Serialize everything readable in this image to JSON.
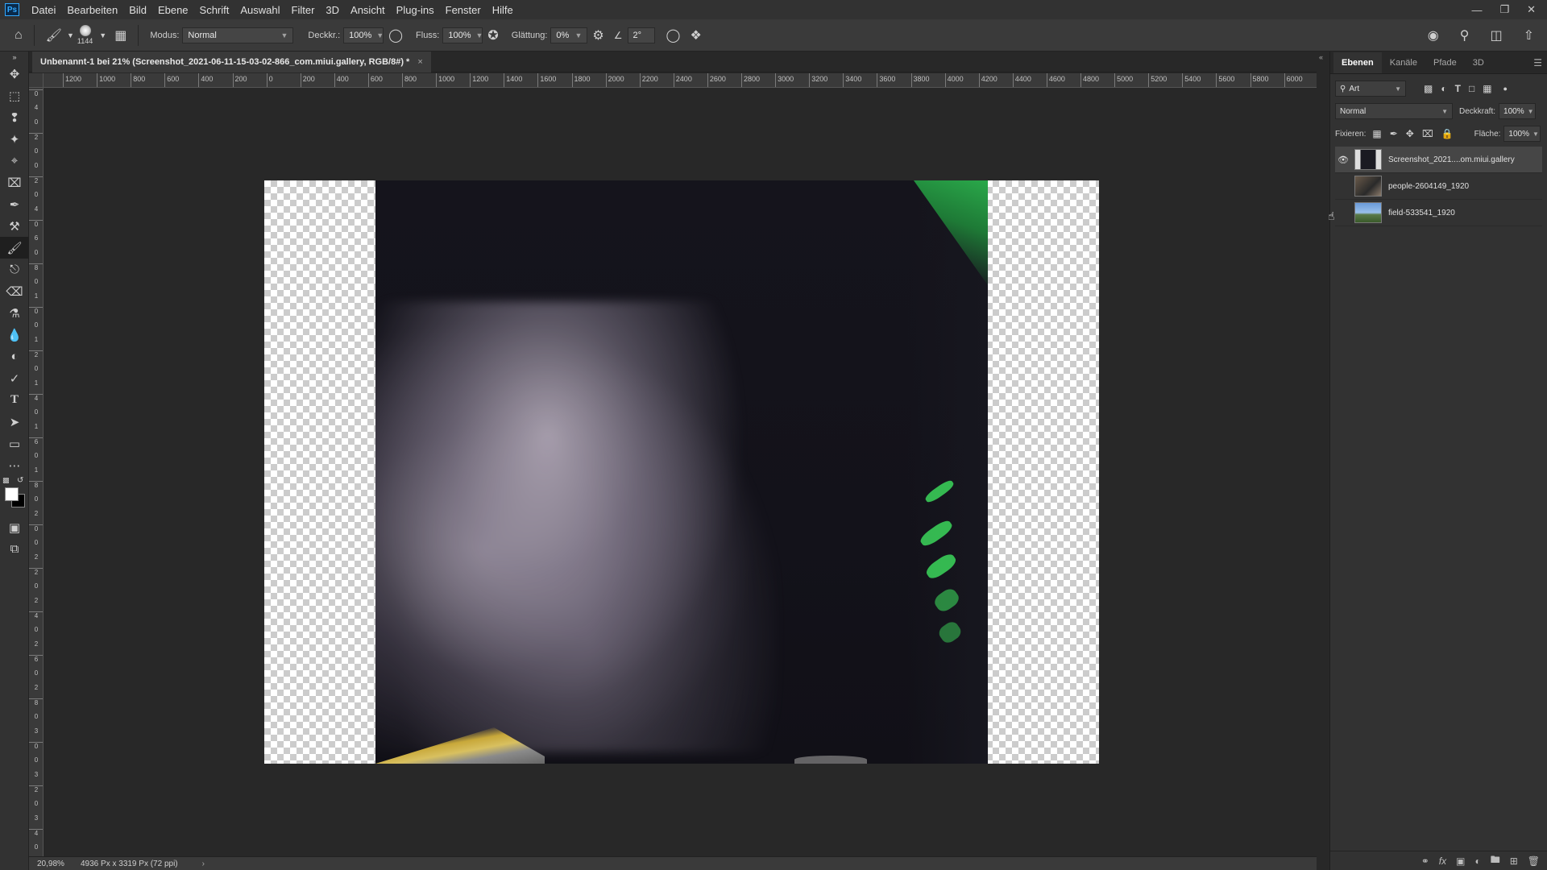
{
  "menubar": {
    "logo": "Ps",
    "items": [
      "Datei",
      "Bearbeiten",
      "Bild",
      "Ebene",
      "Schrift",
      "Auswahl",
      "Filter",
      "3D",
      "Ansicht",
      "Plug-ins",
      "Fenster",
      "Hilfe"
    ]
  },
  "options": {
    "brush_size": "1144",
    "mode_label": "Modus:",
    "mode_value": "Normal",
    "opacity_label": "Deckkr.:",
    "opacity_value": "100%",
    "flow_label": "Fluss:",
    "flow_value": "100%",
    "smoothing_label": "Glättung:",
    "smoothing_value": "0%",
    "angle_value": "2°"
  },
  "document": {
    "tab_title": "Unbenannt-1 bei 21% (Screenshot_2021-06-11-15-03-02-866_com.miui.gallery, RGB/8#) *"
  },
  "ruler": {
    "h_labels": [
      "1200",
      "1000",
      "800",
      "600",
      "400",
      "200",
      "0",
      "200",
      "400",
      "600",
      "800",
      "1000",
      "1200",
      "1400",
      "1600",
      "1800",
      "2000",
      "2200",
      "2400",
      "2600",
      "2800",
      "3000",
      "3200",
      "3400",
      "3600",
      "3800",
      "4000",
      "4200",
      "4400",
      "4600",
      "4800",
      "5000",
      "5200",
      "5400",
      "5600",
      "5800",
      "6000"
    ],
    "v_labels": [
      "0",
      "4",
      "0",
      "2",
      "0",
      "0",
      "2",
      "0",
      "4",
      "0",
      "6",
      "0",
      "8",
      "0",
      "1",
      "0",
      "0",
      "1",
      "2",
      "0",
      "1",
      "4",
      "0",
      "1",
      "6",
      "0",
      "1",
      "8",
      "0",
      "2",
      "0",
      "0",
      "2",
      "2",
      "0",
      "2",
      "4",
      "0",
      "2",
      "6",
      "0",
      "2",
      "8",
      "0",
      "3",
      "0",
      "0",
      "3",
      "2",
      "0",
      "3",
      "4",
      "0"
    ]
  },
  "status": {
    "zoom": "20,98%",
    "doc_size": "4936 Px x 3319 Px (72 ppi)",
    "arrow": "›"
  },
  "panel": {
    "tabs": [
      "Ebenen",
      "Kanäle",
      "Pfade",
      "3D"
    ],
    "filter_label": "Art",
    "blend_mode": "Normal",
    "opacity_label": "Deckkraft:",
    "opacity_value": "100%",
    "lock_label": "Fixieren:",
    "fill_label": "Fläche:",
    "fill_value": "100%",
    "layers": [
      {
        "name": "Screenshot_2021....om.miui.gallery",
        "visible": true,
        "selected": true
      },
      {
        "name": "people-2604149_1920",
        "visible": false,
        "selected": false
      },
      {
        "name": "field-533541_1920",
        "visible": false,
        "selected": false
      }
    ]
  },
  "colors": {
    "foreground": "#ffffff",
    "background": "#000000",
    "accent": "#31a8ff"
  }
}
